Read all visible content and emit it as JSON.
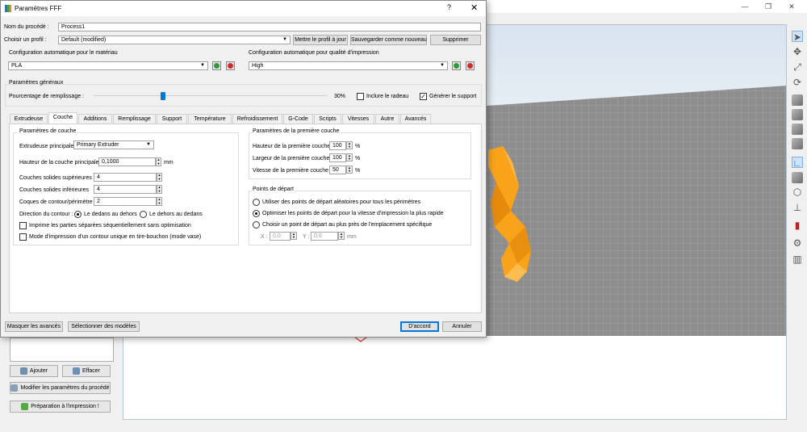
{
  "dialog": {
    "title": "Paramètres FFF",
    "help": "?",
    "close": "✕",
    "procedure_name_label": "Nom du procédé :",
    "procedure_name_value": "Process1",
    "profile_label": "Choisir un profil :",
    "profile_value": "Default (modified)",
    "update_profile_button": "Mettre le profil à jour",
    "save_as_new_button": "Sauvegarder comme nouveau",
    "delete_button": "Supprimer",
    "material_auto_config_label": "Configuration automatique pour le matériau",
    "material_value": "PLA",
    "quality_auto_config_label": "Configuration automatique pour qualité d'impression",
    "quality_value": "High",
    "general_params": {
      "title": "Paramètres généraux",
      "infill_label": "Pourcentage de remplissage :",
      "infill_value": "30%",
      "infill_fraction": 0.3,
      "include_raft_label": "Inclure le radeau",
      "include_raft_checked": false,
      "generate_support_label": "Générer le support",
      "generate_support_checked": true
    },
    "tabs": [
      "Extrudeuse",
      "Couche",
      "Additions",
      "Remplissage",
      "Support",
      "Température",
      "Refroidissement",
      "G-Code",
      "Scripts",
      "Vitesses",
      "Autre",
      "Avancés"
    ],
    "active_tab": "Couche",
    "layer_params": {
      "title": "Paramètres de couche",
      "main_extruder_label": "Extrudeuse principale",
      "main_extruder_value": "Primary Extruder",
      "layer_height_label": "Hauteur de la couche principale",
      "layer_height_value": "0,1000",
      "layer_height_unit": "mm",
      "top_solid_label": "Couches solides supérieures",
      "top_solid_value": "4",
      "bottom_solid_label": "Couches solides inférieures",
      "bottom_solid_value": "4",
      "perimeter_label": "Coques de contour/périmètre",
      "perimeter_value": "2",
      "outline_direction_label": "Direction du contour :",
      "inside_out_label": "Le dedans au dehors",
      "outside_in_label": "Le dehors au dedans",
      "print_islands_label": "Imprime les parties séparées séquentiellement sans optimisation",
      "vase_mode_label": "Mode d'impression d'un contour unique en tire-bouchon (mode vase)"
    },
    "first_layer": {
      "title": "Paramètres de la première couche",
      "height_label": "Hauteur de la première couche",
      "height_value": "100",
      "width_label": "Largeur de la première couche",
      "width_value": "100",
      "speed_label": "Vitesse de la première couche",
      "speed_value": "50",
      "unit": "%"
    },
    "start_points": {
      "title": "Points de départ",
      "random_label": "Utiliser des points de départ aléatoires pour tous les périmètres",
      "optimize_label": "Optimiser les points de départ pour la vitesse d'impression la plus rapide",
      "specific_label": "Choisir un point de départ au plus près de l'emplacement spécifique",
      "x_label": "X :",
      "x_value": "0,0",
      "y_label": "Y :",
      "y_value": "0,0",
      "unit": "mm"
    },
    "hide_advanced_button": "Masquer les avancés",
    "select_models_button": "Sélectionner des modèles",
    "ok_button": "D'accord",
    "cancel_button": "Annuler"
  },
  "left_panel": {
    "add_button": "Ajouter",
    "clear_button": "Effacer",
    "edit_params_button": "Modifier les paramètres du procédé",
    "prepare_print_button": "Préparation à l'impression !"
  },
  "colors": {
    "accent": "#0078d7",
    "model": "#f9a31a",
    "plate": "#8c8c8c",
    "add_green": "#2e9a3a",
    "remove_red": "#d42c2c"
  },
  "icons": [
    "select-arrow-icon",
    "move-icon",
    "scale-icon",
    "rotate-icon",
    "view-cube-icon",
    "axis-icon",
    "settings-gear-icon"
  ]
}
